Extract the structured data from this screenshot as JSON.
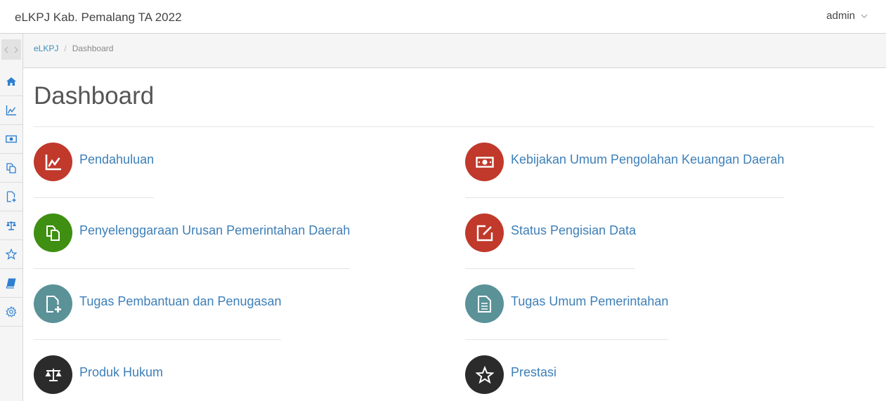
{
  "header": {
    "app_title": "eLKPJ Kab. Pemalang TA 2022",
    "user_label": "admin"
  },
  "breadcrumb": {
    "root": "eLKPJ",
    "separator": "/",
    "current": "Dashboard"
  },
  "page": {
    "title": "Dashboard"
  },
  "colors": {
    "red": "#c0392b",
    "green": "#3f8f12",
    "teal": "#5a9298",
    "dark": "#2b2b2b",
    "link": "#3d7fb8",
    "sidebar_icon": "#2f7fd1"
  },
  "sidebar": {
    "items": [
      {
        "icon": "home-icon"
      },
      {
        "icon": "line-chart-icon"
      },
      {
        "icon": "money-icon"
      },
      {
        "icon": "copy-icon"
      },
      {
        "icon": "file-plus-icon"
      },
      {
        "icon": "balance-scale-icon"
      },
      {
        "icon": "star-icon"
      },
      {
        "icon": "book-icon"
      },
      {
        "icon": "gear-icon"
      }
    ]
  },
  "tiles": [
    {
      "label": "Pendahuluan",
      "icon": "line-chart-icon",
      "color": "red"
    },
    {
      "label": "Kebijakan Umum Pengolahan Keuangan Daerah",
      "icon": "money-icon",
      "color": "red"
    },
    {
      "label": "Penyelenggaraan Urusan Pemerintahan Daerah",
      "icon": "copy-icon",
      "color": "green"
    },
    {
      "label": "Status Pengisian Data",
      "icon": "edit-icon",
      "color": "red"
    },
    {
      "label": "Tugas Pembantuan dan Penugasan",
      "icon": "file-plus-icon",
      "color": "teal"
    },
    {
      "label": "Tugas Umum Pemerintahan",
      "icon": "document-icon",
      "color": "teal"
    },
    {
      "label": "Produk Hukum",
      "icon": "balance-scale-icon",
      "color": "dark"
    },
    {
      "label": "Prestasi",
      "icon": "star-icon",
      "color": "dark"
    }
  ]
}
